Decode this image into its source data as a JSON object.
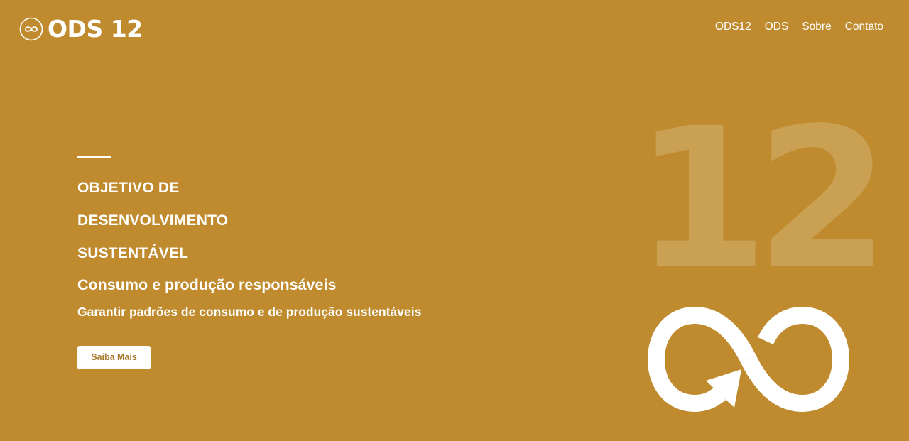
{
  "brand": {
    "logo_icon": "infinity-circle-icon",
    "name": "ODS 12"
  },
  "nav": {
    "items": [
      "ODS12",
      "ODS",
      "Sobre",
      "Contato"
    ]
  },
  "hero": {
    "title_lines": [
      "OBJETIVO DE",
      "DESENVOLVIMENTO",
      "SUSTENTÁVEL"
    ],
    "subtitle": "Consumo e produção responsáveis",
    "description": "Garantir padrões de consumo e de produção sustentáveis",
    "button_label": "Saiba Mais",
    "big_number": "12",
    "graphic_icon": "infinity-arrow-icon"
  },
  "colors": {
    "background": "#BF8B2E",
    "text": "#FFFFFF",
    "button_text": "#A8782A"
  }
}
